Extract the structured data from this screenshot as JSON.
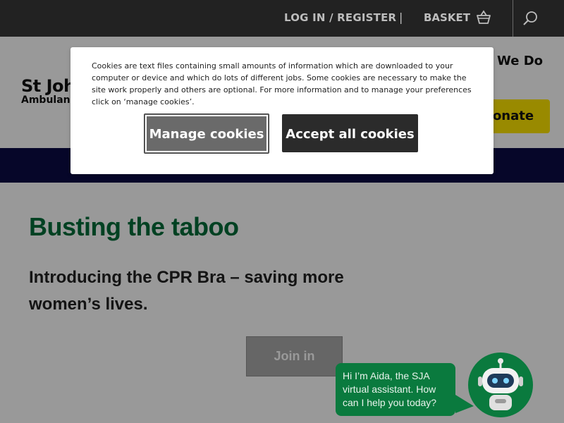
{
  "topbar": {
    "login_label": "LOG IN / REGISTER",
    "separator": "|",
    "basket_label": "BASKET",
    "basket_icon": "basket-icon",
    "search_icon": "search-icon"
  },
  "header": {
    "logo_line1": "St John",
    "logo_line2": "Ambulance",
    "what_we_do_label": "We Do",
    "donate_label": "Donate",
    "donate_color": "#ffe600"
  },
  "navbar": {
    "color": "#0b0b45"
  },
  "hero": {
    "title": "Busting the taboo",
    "subtitle": "Introducing the CPR Bra – saving more women’s lives.",
    "join_label": "Join in",
    "title_color": "#006d3a"
  },
  "cookie_banner": {
    "text": "Cookies are text files containing small amounts of information which are downloaded to your computer or device and which do lots of different jobs. Some cookies are necessary to make the site work properly and others are optional. For more information and to manage your preferences click on ‘manage cookies’.",
    "manage_label": "Manage cookies",
    "accept_label": "Accept all cookies"
  },
  "chat": {
    "message": "Hi I’m Aida, the SJA virtual assistant. How can I help you today?",
    "avatar_icon": "robot-icon",
    "accent": "#0a7a3e"
  }
}
